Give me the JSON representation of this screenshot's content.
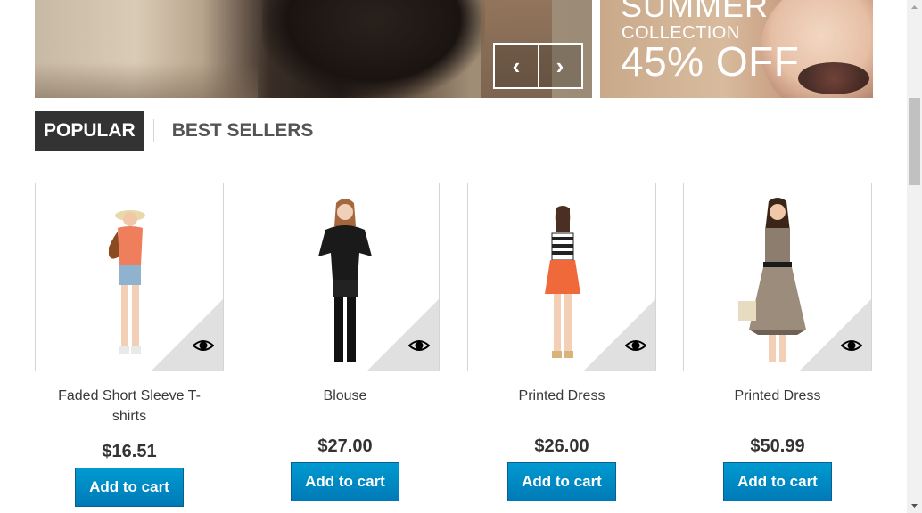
{
  "slider": {
    "prev_glyph": "‹",
    "next_glyph": "›"
  },
  "promo": {
    "line1": "SUMMER",
    "line2": "COLLECTION",
    "line3": "45% OFF"
  },
  "tabs": {
    "active": "POPULAR",
    "other": "BEST SELLERS"
  },
  "products": [
    {
      "name": "Faded Short Sleeve T-shirts",
      "price": "$16.51",
      "button": "Add to cart"
    },
    {
      "name": "Blouse",
      "price": "$27.00",
      "button": "Add to cart"
    },
    {
      "name": "Printed Dress",
      "price": "$26.00",
      "button": "Add to cart"
    },
    {
      "name": "Printed Dress",
      "price": "$50.99",
      "button": "Add to cart"
    }
  ],
  "colors": {
    "accent": "#0079b6",
    "tab_active_bg": "#333333",
    "corner": "#e0e0e0"
  },
  "icons": [
    "chevron-left-icon",
    "chevron-right-icon",
    "eye-icon"
  ]
}
